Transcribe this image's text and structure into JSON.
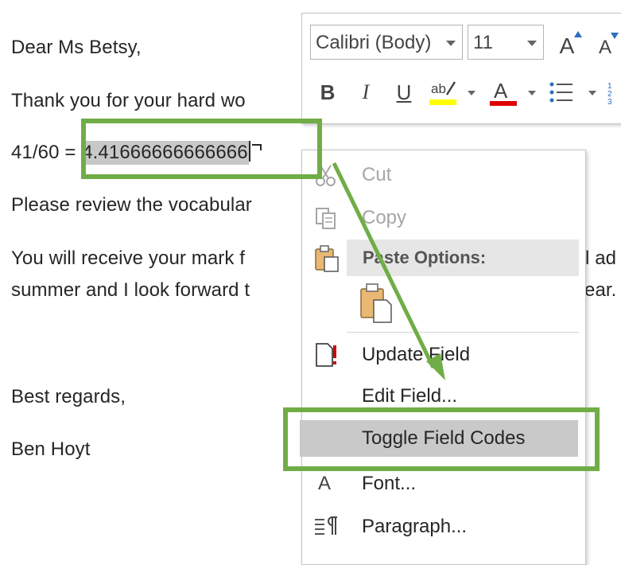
{
  "document": {
    "greeting": "Dear Ms Betsy,",
    "line_thanks": "Thank you for your hard wo",
    "formula_prefix": "41/60 = ",
    "field_value": "4.41666666666666",
    "line_review": "Please review the vocabular",
    "line_mark_part1": "You will receive your mark f",
    "line_mark_part1_tail": "l ad",
    "line_mark_part2": "summer and I look forward t",
    "line_mark_part2_tail": "ear.",
    "closing": "Best regards,",
    "signature": "Ben Hoyt"
  },
  "mini_toolbar": {
    "font_name": "Calibri (Body)",
    "font_size": "11",
    "grow_font": "A",
    "shrink_font": "A",
    "bold": "B",
    "italic": "I",
    "underline": "U",
    "font_color_letter": "A",
    "highlight_color": "#ffff00",
    "font_color": "#e00000"
  },
  "context_menu": {
    "cut": "Cut",
    "copy": "Copy",
    "paste_options_header": "Paste Options:",
    "update_field": "Update Field",
    "edit_field": "Edit Field...",
    "toggle_field_codes": "Toggle Field Codes",
    "font": "Font...",
    "paragraph": "Paragraph..."
  },
  "annotation": {
    "highlight_color": "#70ad47"
  }
}
